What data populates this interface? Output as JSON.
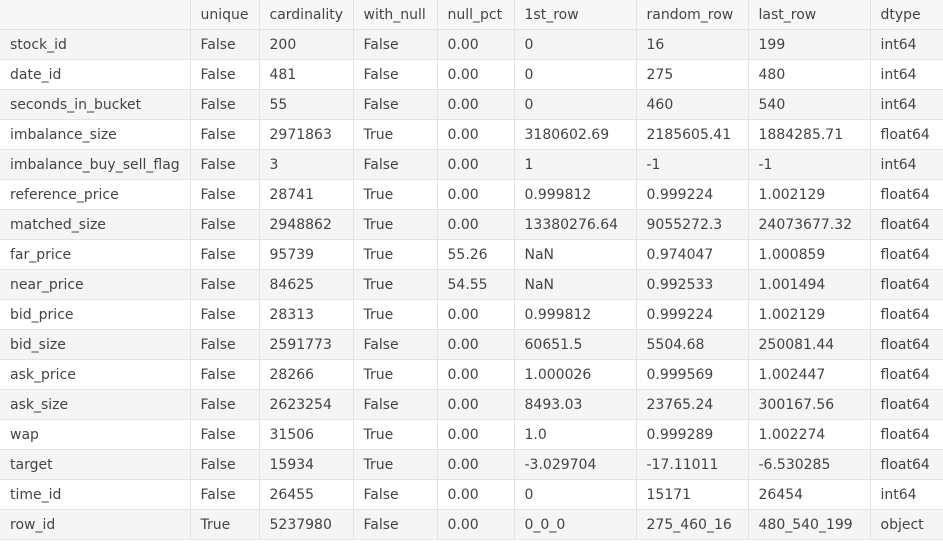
{
  "table": {
    "columns": [
      "",
      "unique",
      "cardinality",
      "with_null",
      "null_pct",
      "1st_row",
      "random_row",
      "last_row",
      "dtype"
    ],
    "rows": [
      [
        "stock_id",
        "False",
        "200",
        "False",
        "0.00",
        "0",
        "16",
        "199",
        "int64"
      ],
      [
        "date_id",
        "False",
        "481",
        "False",
        "0.00",
        "0",
        "275",
        "480",
        "int64"
      ],
      [
        "seconds_in_bucket",
        "False",
        "55",
        "False",
        "0.00",
        "0",
        "460",
        "540",
        "int64"
      ],
      [
        "imbalance_size",
        "False",
        "2971863",
        "True",
        "0.00",
        "3180602.69",
        "2185605.41",
        "1884285.71",
        "float64"
      ],
      [
        "imbalance_buy_sell_flag",
        "False",
        "3",
        "False",
        "0.00",
        "1",
        "-1",
        "-1",
        "int64"
      ],
      [
        "reference_price",
        "False",
        "28741",
        "True",
        "0.00",
        "0.999812",
        "0.999224",
        "1.002129",
        "float64"
      ],
      [
        "matched_size",
        "False",
        "2948862",
        "True",
        "0.00",
        "13380276.64",
        "9055272.3",
        "24073677.32",
        "float64"
      ],
      [
        "far_price",
        "False",
        "95739",
        "True",
        "55.26",
        "NaN",
        "0.974047",
        "1.000859",
        "float64"
      ],
      [
        "near_price",
        "False",
        "84625",
        "True",
        "54.55",
        "NaN",
        "0.992533",
        "1.001494",
        "float64"
      ],
      [
        "bid_price",
        "False",
        "28313",
        "True",
        "0.00",
        "0.999812",
        "0.999224",
        "1.002129",
        "float64"
      ],
      [
        "bid_size",
        "False",
        "2591773",
        "False",
        "0.00",
        "60651.5",
        "5504.68",
        "250081.44",
        "float64"
      ],
      [
        "ask_price",
        "False",
        "28266",
        "True",
        "0.00",
        "1.000026",
        "0.999569",
        "1.002447",
        "float64"
      ],
      [
        "ask_size",
        "False",
        "2623254",
        "False",
        "0.00",
        "8493.03",
        "23765.24",
        "300167.56",
        "float64"
      ],
      [
        "wap",
        "False",
        "31506",
        "True",
        "0.00",
        "1.0",
        "0.999289",
        "1.002274",
        "float64"
      ],
      [
        "target",
        "False",
        "15934",
        "True",
        "0.00",
        "-3.029704",
        "-17.11011",
        "-6.530285",
        "float64"
      ],
      [
        "time_id",
        "False",
        "26455",
        "False",
        "0.00",
        "0",
        "15171",
        "26454",
        "int64"
      ],
      [
        "row_id",
        "True",
        "5237980",
        "False",
        "0.00",
        "0_0_0",
        "275_460_16",
        "480_540_199",
        "object"
      ]
    ]
  }
}
